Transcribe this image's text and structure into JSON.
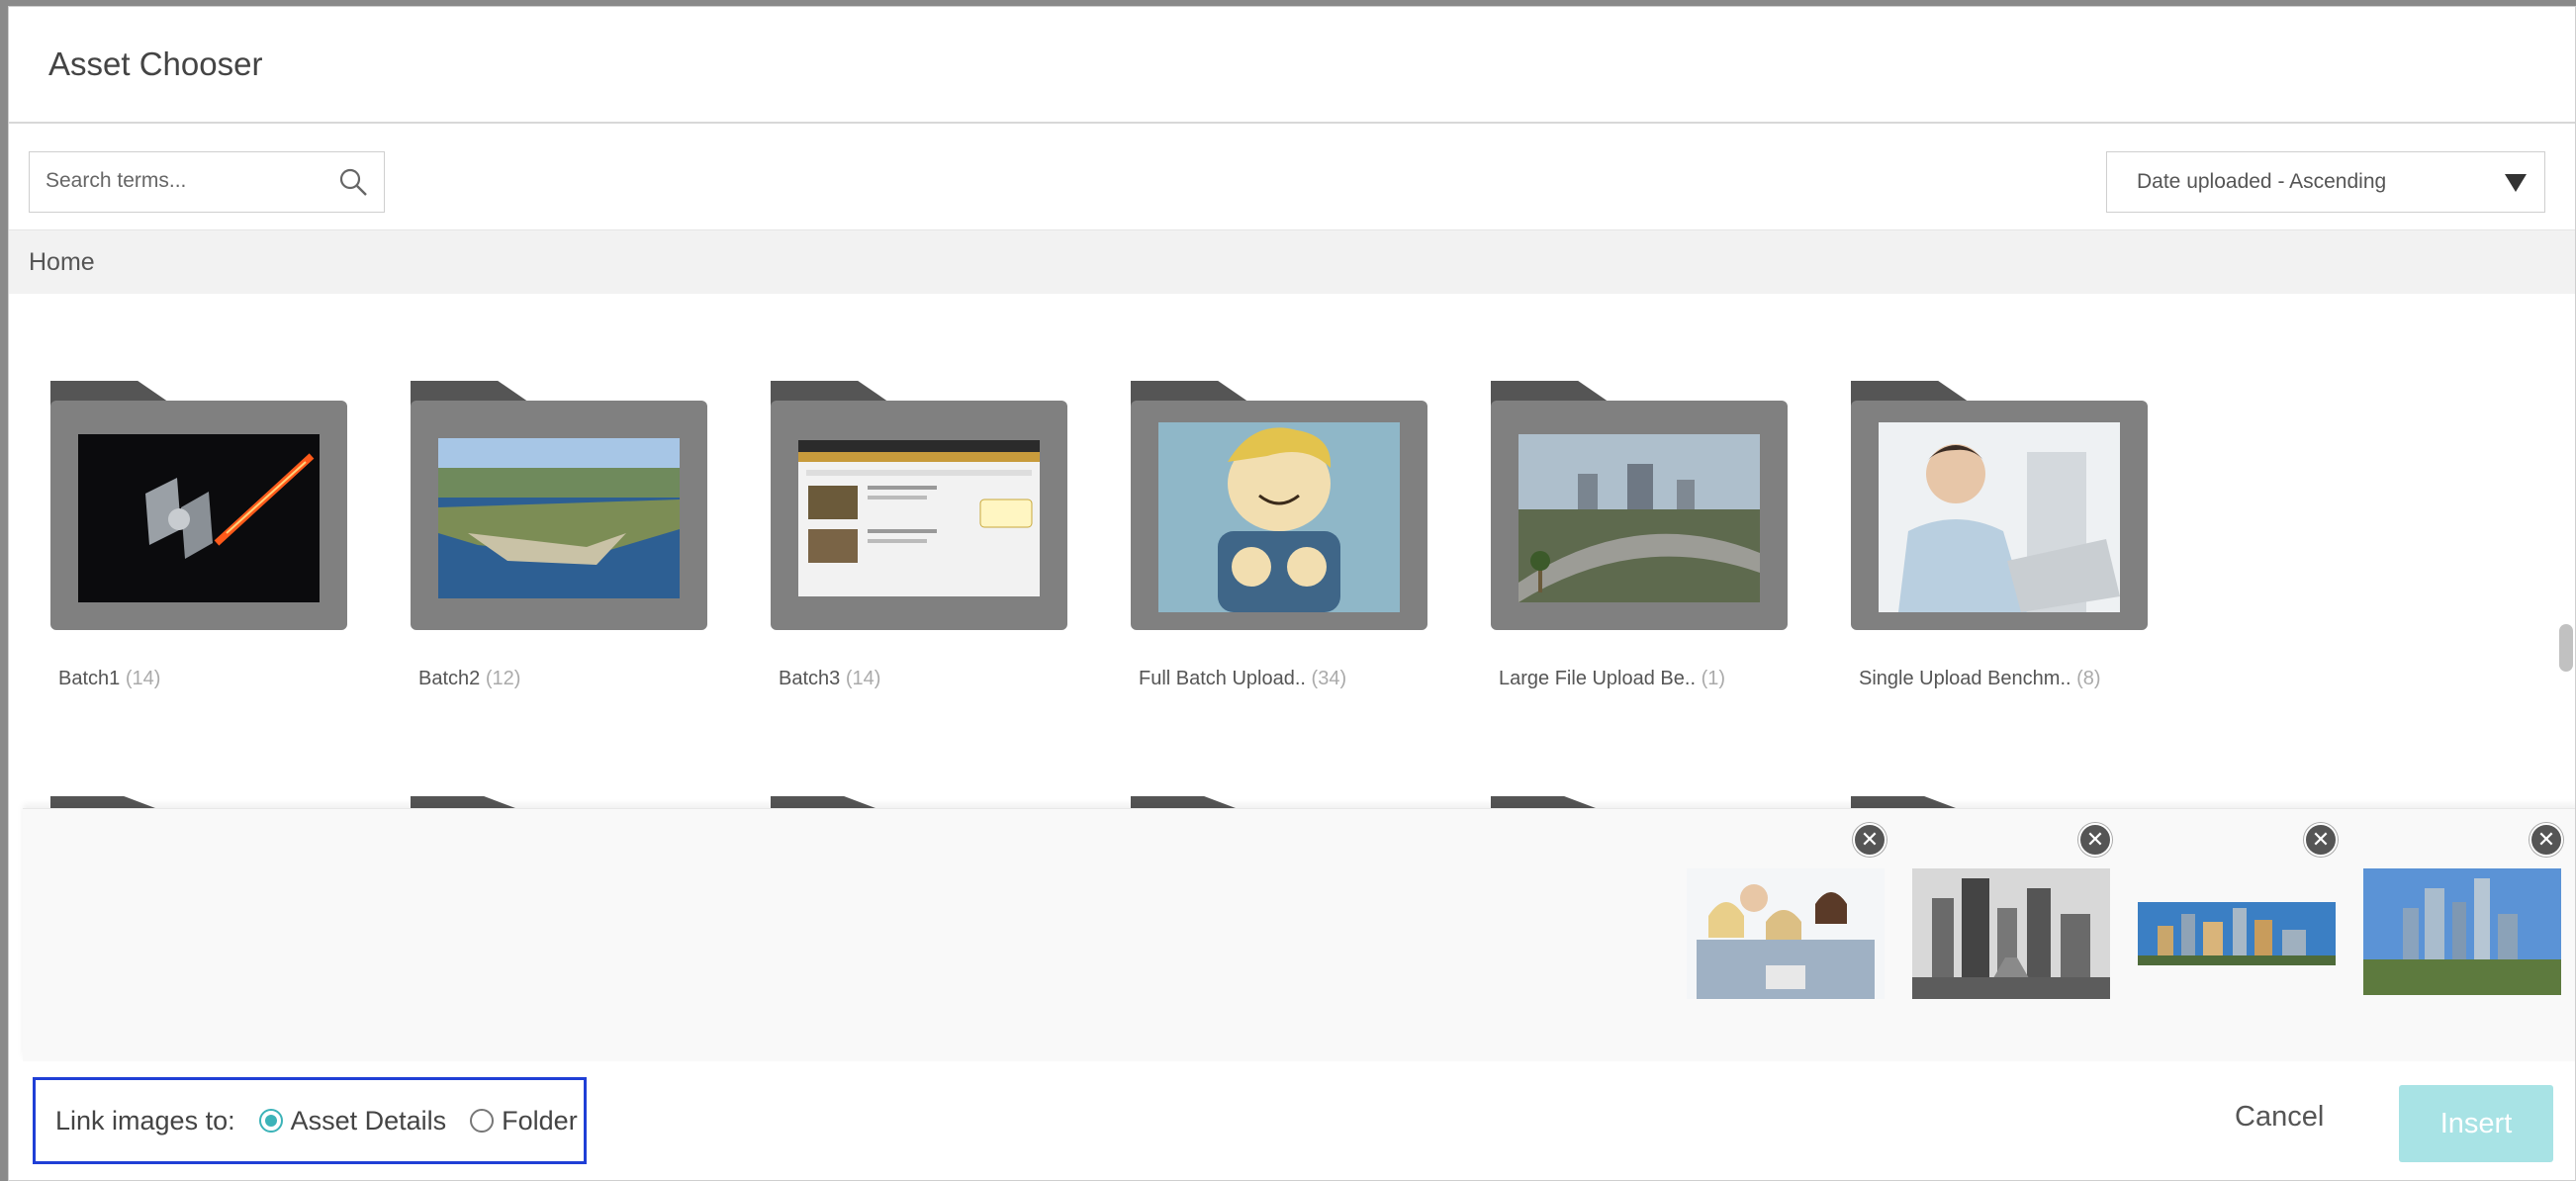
{
  "dialog": {
    "title": "Asset Chooser"
  },
  "search": {
    "placeholder": "Search terms..."
  },
  "sort": {
    "selected": "Date uploaded - Ascending"
  },
  "breadcrumb": {
    "home": "Home"
  },
  "folders": [
    {
      "name": "Batch1",
      "count": "(14)"
    },
    {
      "name": "Batch2",
      "count": "(12)"
    },
    {
      "name": "Batch3",
      "count": "(14)"
    },
    {
      "name": "Full Batch Upload..",
      "count": "(34)"
    },
    {
      "name": "Large File Upload Be..",
      "count": "(1)"
    },
    {
      "name": "Single Upload Benchm..",
      "count": "(8)"
    }
  ],
  "selected_images": [
    "business-team",
    "city-street",
    "skyline-panorama",
    "city-skyline"
  ],
  "footer": {
    "link_label": "Link images to:",
    "option_asset_details": "Asset Details",
    "option_folder": "Folder",
    "cancel": "Cancel",
    "insert": "Insert"
  },
  "colors": {
    "accent": "#3cb3b8",
    "insert_bg": "#a8e3e5",
    "focus_border": "#1f3fd6"
  }
}
